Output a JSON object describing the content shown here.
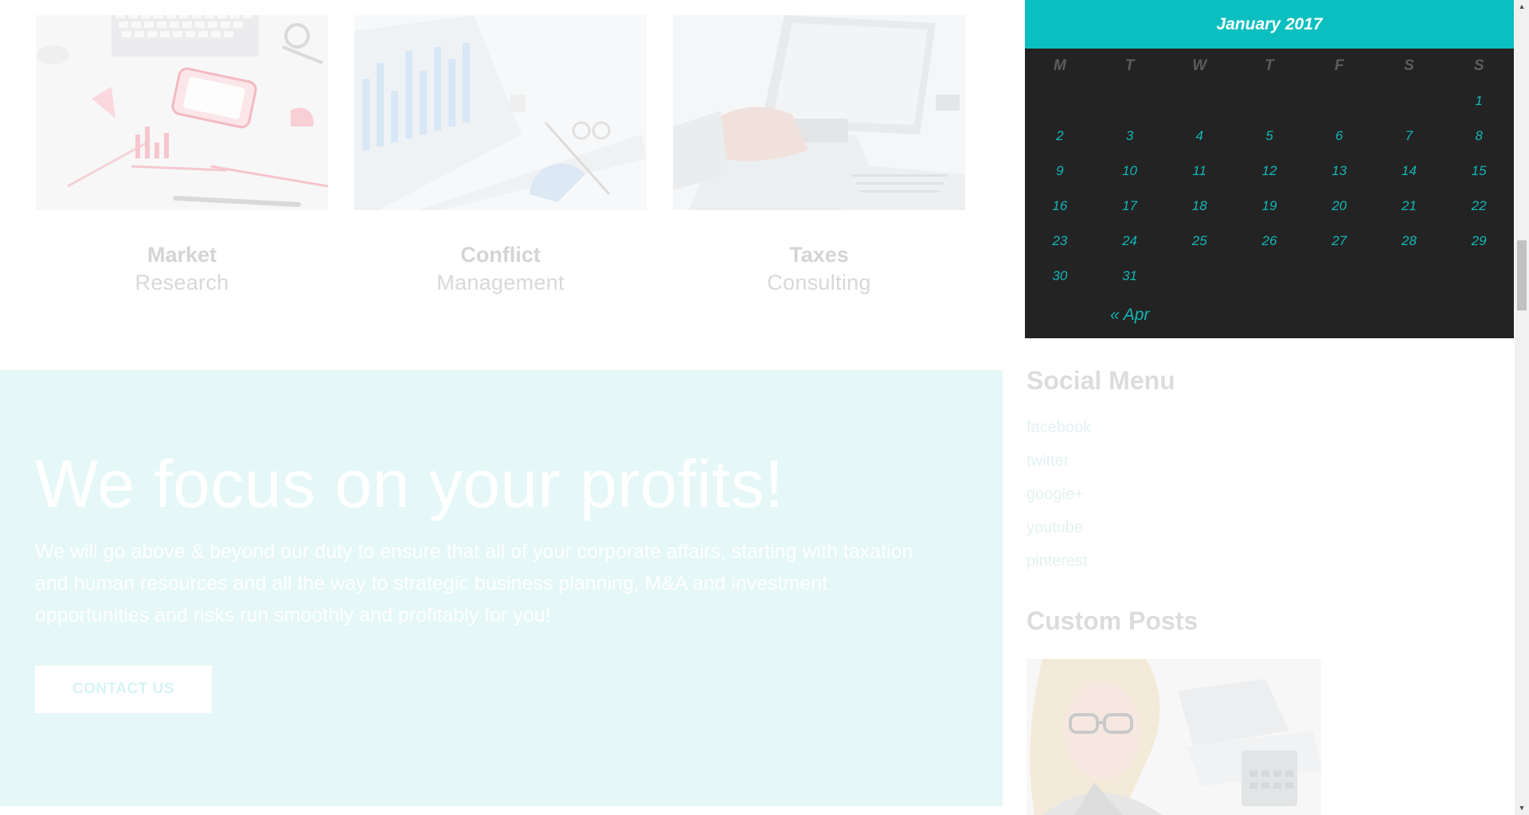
{
  "services": [
    {
      "title": "Market",
      "subtitle": "Research",
      "image": "office-desk-photo"
    },
    {
      "title": "Conflict",
      "subtitle": "Management",
      "image": "charts-photo"
    },
    {
      "title": "Taxes",
      "subtitle": "Consulting",
      "image": "calculator-photo"
    }
  ],
  "hero": {
    "heading": "We focus on your profits!",
    "body": "We will go above & beyond our duty to ensure that all of your corporate affairs, starting with taxation and human resources and all the way to strategic business planning, M&A and investment opportunities and risks run smoothly and profitably for you!",
    "button_label": "CONTACT US",
    "background": "#e5f7f7"
  },
  "calendar": {
    "caption": "January 2017",
    "days_of_week": [
      "M",
      "T",
      "W",
      "T",
      "F",
      "S",
      "S"
    ],
    "weeks": [
      [
        "",
        "",
        "",
        "",
        "",
        "",
        "1"
      ],
      [
        "2",
        "3",
        "4",
        "5",
        "6",
        "7",
        "8"
      ],
      [
        "9",
        "10",
        "11",
        "12",
        "13",
        "14",
        "15"
      ],
      [
        "16",
        "17",
        "18",
        "19",
        "20",
        "21",
        "22"
      ],
      [
        "23",
        "24",
        "25",
        "26",
        "27",
        "28",
        "29"
      ],
      [
        "30",
        "31",
        "",
        "",
        "",
        "",
        ""
      ]
    ],
    "prev_link": "« Apr",
    "accent_color": "#0bbfc0"
  },
  "social_menu": {
    "title": "Social Menu",
    "items": [
      "facebook",
      "twitter",
      "google+",
      "youtube",
      "pinterest"
    ]
  },
  "custom_posts": {
    "title": "Custom Posts",
    "image": "businesswoman-photo"
  }
}
